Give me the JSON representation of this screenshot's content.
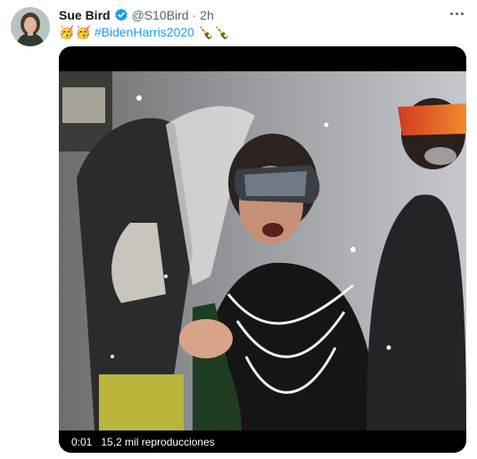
{
  "tweet": {
    "author_name": "Sue Bird",
    "verified_icon": "verified-badge-icon",
    "handle": "@S10Bird",
    "separator": "·",
    "time": "2h",
    "more_icon": "more-options-icon",
    "text": {
      "emojis_before": [
        "🥳",
        "🥳"
      ],
      "hashtag": "#BidenHarris2020",
      "emojis_after": [
        "🍾",
        "🍾"
      ]
    }
  },
  "video": {
    "elapsed": "0:01",
    "views": "15,2 mil reproducciones"
  },
  "colors": {
    "link": "#1d9bf0",
    "secondary_text": "#536471",
    "verified": "#1d9bf0"
  }
}
